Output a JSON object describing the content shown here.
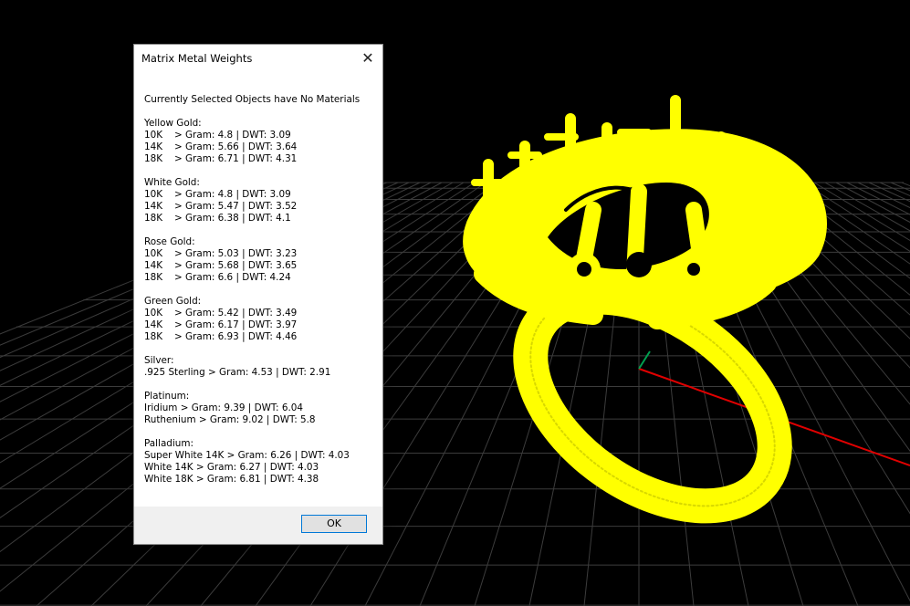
{
  "dialog": {
    "title": "Matrix Metal Weights",
    "close_glyph": "✕",
    "header": "Currently Selected Objects have No Materials",
    "sections": [
      {
        "title": "Yellow Gold:",
        "rows": [
          {
            "karat": "10K",
            "value": "> Gram: 4.8 | DWT: 3.09"
          },
          {
            "karat": "14K",
            "value": "> Gram: 5.66 | DWT: 3.64"
          },
          {
            "karat": "18K",
            "value": "> Gram: 6.71 | DWT: 4.31"
          }
        ]
      },
      {
        "title": "White Gold:",
        "rows": [
          {
            "karat": "10K",
            "value": "> Gram: 4.8 | DWT: 3.09"
          },
          {
            "karat": "14K",
            "value": "> Gram: 5.47 | DWT: 3.52"
          },
          {
            "karat": "18K",
            "value": "> Gram: 6.38 | DWT: 4.1"
          }
        ]
      },
      {
        "title": "Rose Gold:",
        "rows": [
          {
            "karat": "10K",
            "value": "> Gram: 5.03 | DWT: 3.23"
          },
          {
            "karat": "14K",
            "value": "> Gram: 5.68 | DWT: 3.65"
          },
          {
            "karat": "18K",
            "value": "> Gram: 6.6 | DWT: 4.24"
          }
        ]
      },
      {
        "title": "Green Gold:",
        "rows": [
          {
            "karat": "10K",
            "value": "> Gram: 5.42 | DWT: 3.49"
          },
          {
            "karat": "14K",
            "value": "> Gram: 6.17 | DWT: 3.97"
          },
          {
            "karat": "18K",
            "value": "> Gram: 6.93 | DWT: 4.46"
          }
        ]
      },
      {
        "title": "Silver:",
        "lines": [
          ".925 Sterling > Gram: 4.53 | DWT: 2.91"
        ]
      },
      {
        "title": "Platinum:",
        "lines": [
          "Iridium > Gram: 9.39 | DWT: 6.04",
          "Ruthenium > Gram: 9.02 | DWT: 5.8"
        ]
      },
      {
        "title": "Palladium:",
        "lines": [
          "Super White 14K > Gram: 6.26 | DWT: 4.03",
          "White 14K > Gram: 6.27 | DWT: 4.03",
          "White 18K > Gram: 6.81 | DWT: 4.38"
        ]
      }
    ],
    "ok_label": "OK"
  },
  "viewport": {
    "background": "#000000",
    "grid_color": "#3c3c3c",
    "model_color": "#ffff00",
    "axis_x_color": "#e00000",
    "axis_y_color": "#00a050"
  }
}
